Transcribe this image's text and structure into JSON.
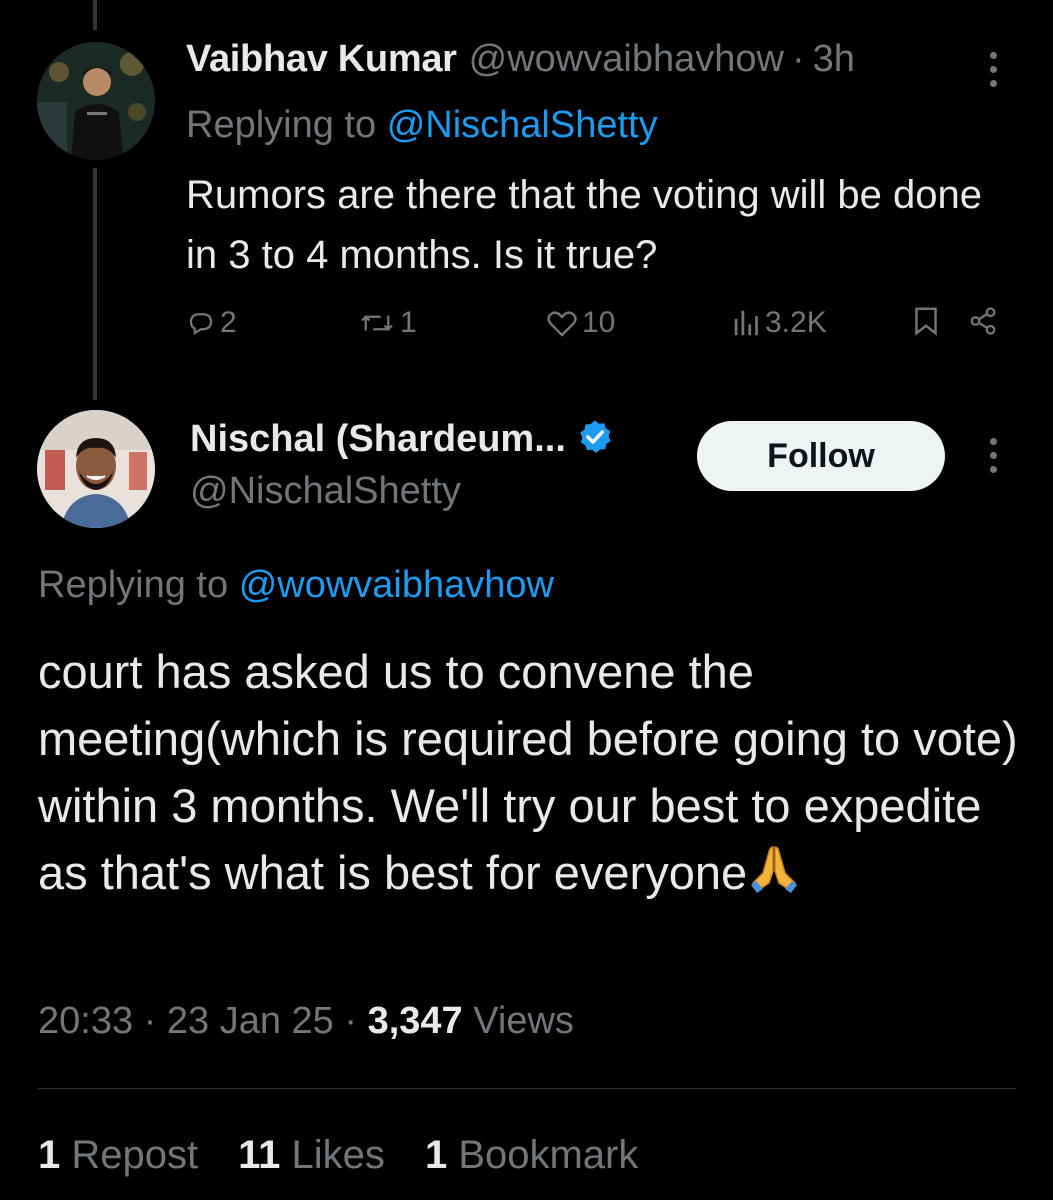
{
  "parent_tweet": {
    "author_name": "Vaibhav Kumar",
    "author_handle": "@wowvaibhavhow",
    "separator": "·",
    "time": "3h",
    "replying_prefix": "Replying to",
    "replying_to": "@NischalShetty",
    "text": "Rumors are there that the voting will be done in 3 to 4 months. Is it true?",
    "replies": "2",
    "reposts": "1",
    "likes": "10",
    "views": "3.2K"
  },
  "reply_tweet": {
    "author_name": "Nischal (Shardeum...",
    "author_handle": "@NischalShetty",
    "follow_label": "Follow",
    "replying_prefix": "Replying to",
    "replying_to": "@wowvaibhavhow",
    "text": "court has asked us to convene the meeting(which is required before going to vote) within 3 months. We'll try our best to expedite as that's what is best for everyone",
    "time": "20:33",
    "sep1": "·",
    "date": "23 Jan 25",
    "sep2": "·",
    "view_count": "3,347",
    "views_label": "Views",
    "stats": {
      "repost_count": "1",
      "repost_label": "Repost",
      "like_count": "11",
      "like_label": "Likes",
      "bookmark_count": "1",
      "bookmark_label": "Bookmark"
    }
  },
  "colors": {
    "background": "#000000",
    "text": "#e7e9ea",
    "secondary": "#71767b",
    "accent": "#1d9bf0",
    "follow_bg": "#eff3f4"
  },
  "icons": [
    "reply-icon",
    "repost-icon",
    "like-icon",
    "views-icon",
    "bookmark-icon",
    "share-icon",
    "verified-icon",
    "more-icon",
    "folded-hands-emoji"
  ]
}
